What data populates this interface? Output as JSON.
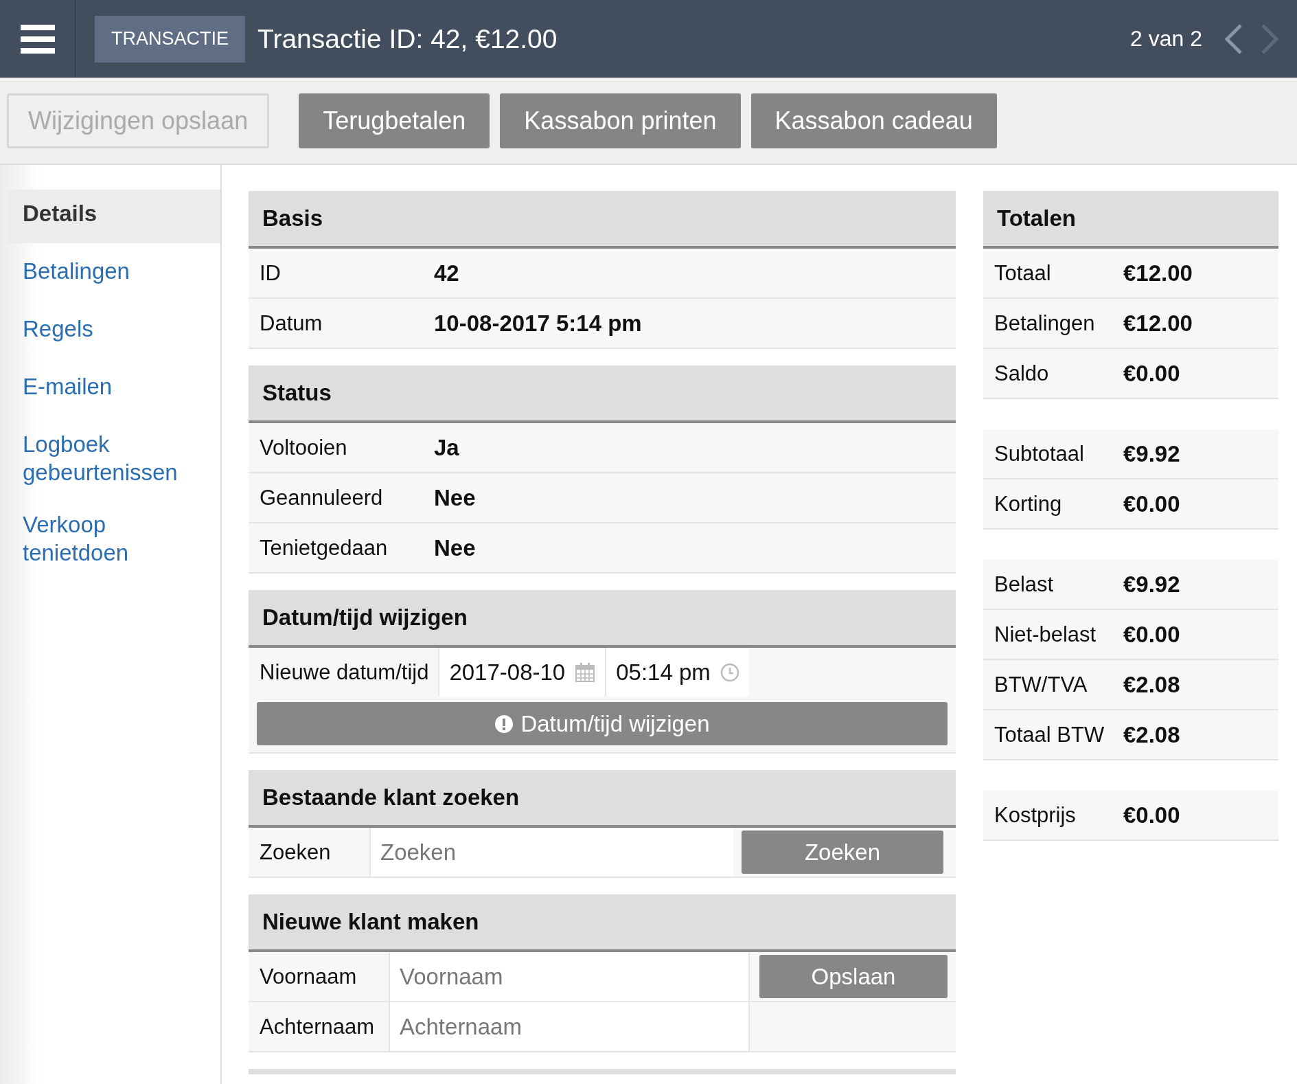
{
  "header": {
    "badge": "TRANSACTIE",
    "title": "Transactie ID: 42, €12.00",
    "pager": "2 van 2"
  },
  "toolbar": [
    {
      "label": "Wijzigingen opslaan",
      "disabled": true
    },
    {
      "label": "Terugbetalen",
      "disabled": false
    },
    {
      "label": "Kassabon printen",
      "disabled": false
    },
    {
      "label": "Kassabon cadeau",
      "disabled": false
    }
  ],
  "sidebar": {
    "items": [
      {
        "label": "Details",
        "selected": true
      },
      {
        "label": "Betalingen",
        "selected": false
      },
      {
        "label": "Regels",
        "selected": false
      },
      {
        "label": "E-mailen",
        "selected": false
      },
      {
        "label": "Logboek gebeurtenissen",
        "selected": false
      },
      {
        "label": "Verkoop tenietdoen",
        "selected": false
      }
    ]
  },
  "sections": [
    {
      "kind": "fields",
      "title": "Basis",
      "rows": [
        {
          "label": "ID",
          "value": "42"
        },
        {
          "label": "Datum",
          "value": "10-08-2017 5:14 pm"
        }
      ]
    },
    {
      "kind": "fields",
      "title": "Status",
      "rows": [
        {
          "label": "Voltooien",
          "value": "Ja"
        },
        {
          "label": "Geannuleerd",
          "value": "Nee"
        },
        {
          "label": "Tenietgedaan",
          "value": "Nee"
        }
      ]
    },
    {
      "kind": "datetime",
      "title": "Datum/tijd wijzigen",
      "label": "Nieuwe datum/tijd",
      "date": "2017-08-10",
      "time": "05:14 pm",
      "button": "Datum/tijd wijzigen"
    },
    {
      "kind": "search",
      "title": "Bestaande klant zoeken",
      "label": "Zoeken",
      "placeholder": "Zoeken",
      "button": "Zoeken"
    },
    {
      "kind": "customer",
      "title": "Nieuwe klant maken",
      "fields": [
        {
          "label": "Voornaam",
          "placeholder": "Voornaam"
        },
        {
          "label": "Achternaam",
          "placeholder": "Achternaam"
        }
      ],
      "button": "Opslaan"
    }
  ],
  "totals": {
    "title": "Totalen",
    "groups": [
      [
        {
          "label": "Totaal",
          "value": "€12.00"
        },
        {
          "label": "Betalingen",
          "value": "€12.00"
        },
        {
          "label": "Saldo",
          "value": "€0.00"
        }
      ],
      [
        {
          "label": "Subtotaal",
          "value": "€9.92"
        },
        {
          "label": "Korting",
          "value": "€0.00"
        }
      ],
      [
        {
          "label": "Belast",
          "value": "€9.92"
        },
        {
          "label": "Niet-belast",
          "value": "€0.00"
        },
        {
          "label": "BTW/TVA",
          "value": "€2.08"
        },
        {
          "label": "Totaal BTW",
          "value": "€2.08"
        }
      ],
      [
        {
          "label": "Kostprijs",
          "value": "€0.00"
        }
      ]
    ]
  }
}
